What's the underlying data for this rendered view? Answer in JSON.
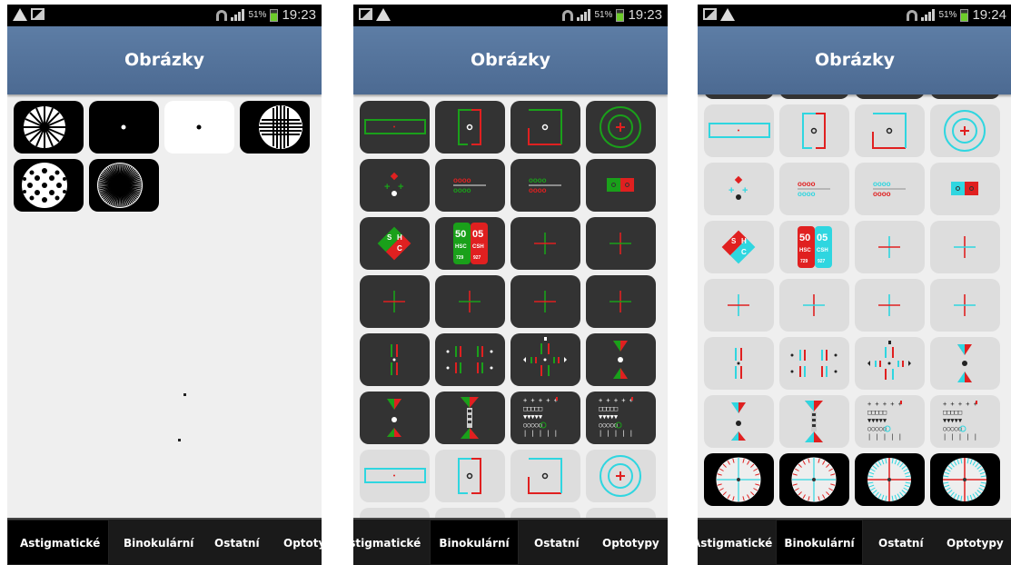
{
  "screens": [
    {
      "status": {
        "battery": "51%",
        "time": "19:23"
      },
      "title": "Obrázky",
      "tabs": [
        "Astigmatické",
        "Binokulární",
        "Ostatní",
        "Optotypy"
      ],
      "selected_tab": 0
    },
    {
      "status": {
        "battery": "51%",
        "time": "19:23"
      },
      "title": "Obrázky",
      "tabs": [
        "Astigmatické",
        "Binokulární",
        "Ostatní",
        "Optotypy"
      ],
      "selected_tab": 1
    },
    {
      "status": {
        "battery": "51%",
        "time": "19:24"
      },
      "title": "Obrázky",
      "tabs": [
        "Astigmatické",
        "Binokulární",
        "Ostatní",
        "Optotypy"
      ],
      "selected_tab": 1
    }
  ],
  "test_labels": {
    "left_numbers": "50",
    "right_numbers": "05",
    "left_code": "HSC",
    "right_code": "CSH",
    "left_sub": "729",
    "right_sub": "927",
    "diamond_letters": [
      "S",
      "H",
      "C"
    ]
  },
  "colors": {
    "red": "#e02020",
    "green": "#1aa01a",
    "cyan": "#2fd6e0",
    "titlebar": "#5676a0"
  }
}
